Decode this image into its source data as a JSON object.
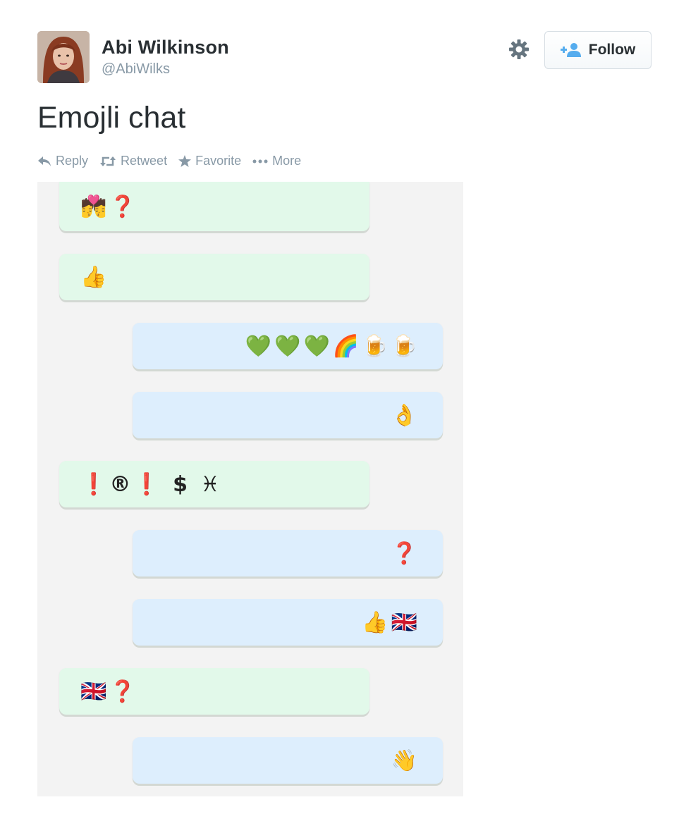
{
  "user": {
    "name": "Abi Wilkinson",
    "handle": "@AbiWilks"
  },
  "follow_button": {
    "label": "Follow"
  },
  "tweet": {
    "text": "Emojli chat"
  },
  "actions": [
    {
      "label": "Reply",
      "icon": "reply-icon"
    },
    {
      "label": "Retweet",
      "icon": "retweet-icon"
    },
    {
      "label": "Favorite",
      "icon": "star-icon"
    },
    {
      "label": "More",
      "icon": "more-icon"
    }
  ],
  "chat": {
    "messages": [
      {
        "side": "incoming",
        "content": "💏❓"
      },
      {
        "side": "incoming",
        "content": "👍"
      },
      {
        "side": "outgoing",
        "content": "💚💚💚🌈🍺🍺"
      },
      {
        "side": "outgoing",
        "content": "👌"
      },
      {
        "side": "incoming",
        "content": "❗®❗ $ ♓"
      },
      {
        "side": "outgoing",
        "content": "❓"
      },
      {
        "side": "outgoing",
        "content": "👍🇬🇧"
      },
      {
        "side": "incoming",
        "content": "🇬🇧❓"
      },
      {
        "side": "outgoing",
        "content": "👋"
      }
    ]
  },
  "colors": {
    "incoming_bubble": "#e2f9ea",
    "outgoing_bubble": "#ddeefd",
    "chat_background": "#f3f3f3",
    "muted_text": "#8899a6",
    "follow_icon": "#55acee"
  }
}
